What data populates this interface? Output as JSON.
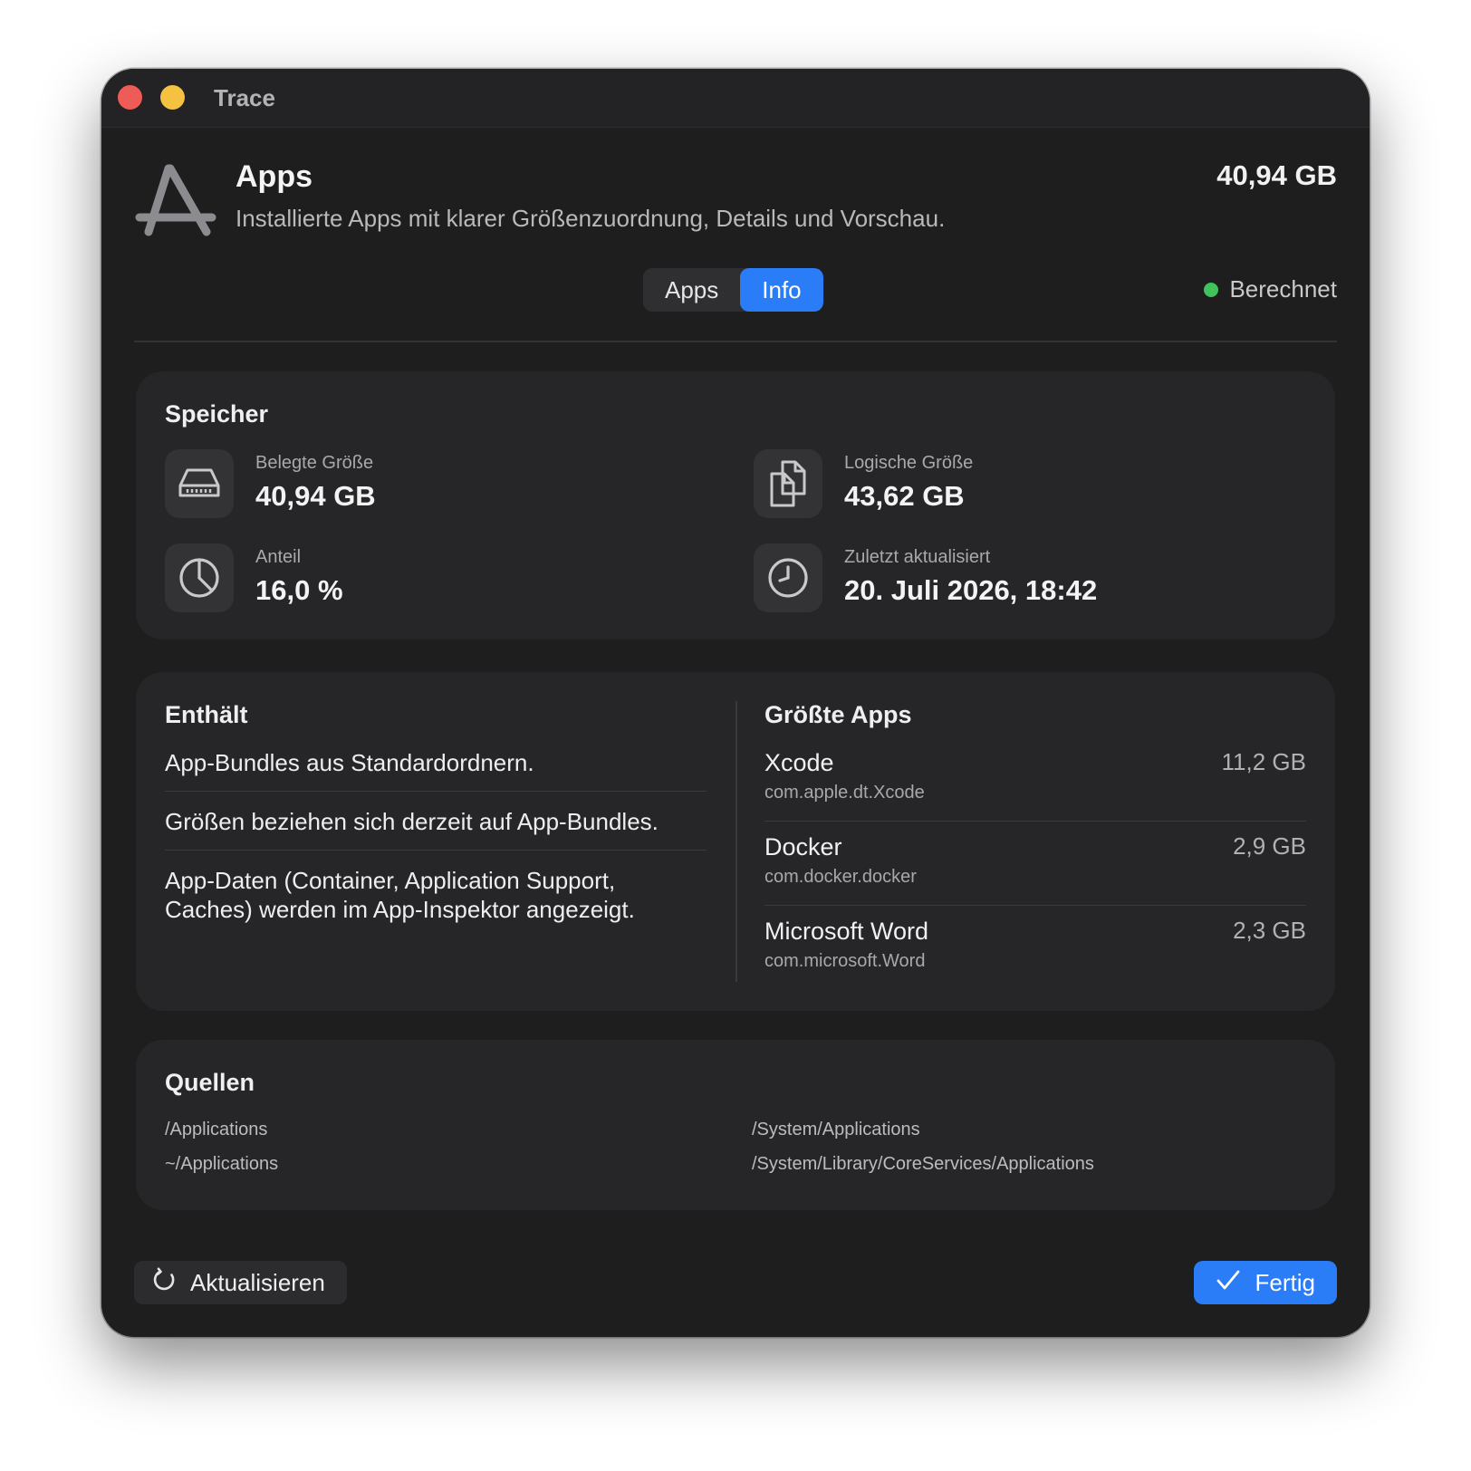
{
  "window": {
    "title": "Trace"
  },
  "header": {
    "icon": "app-store-icon",
    "title": "Apps",
    "subtitle": "Installierte Apps mit klarer Größenzuordnung, Details und Vorschau.",
    "total_size": "40,94 GB"
  },
  "tabs": [
    {
      "label": "Apps",
      "active": false
    },
    {
      "label": "Info",
      "active": true
    }
  ],
  "status": {
    "label": "Berechnet",
    "color": "#3fc35a"
  },
  "speicher": {
    "title": "Speicher",
    "stats": [
      {
        "icon": "drive-icon",
        "label": "Belegte Größe",
        "value": "40,94 GB"
      },
      {
        "icon": "documents-icon",
        "label": "Logische Größe",
        "value": "43,62 GB"
      },
      {
        "icon": "pie-chart-icon",
        "label": "Anteil",
        "value": "16,0 %"
      },
      {
        "icon": "clock-icon",
        "label": "Zuletzt aktualisiert",
        "value": "20. Juli 2026, 18:42"
      }
    ]
  },
  "enthaelt": {
    "title": "Enthält",
    "items": [
      "App-Bundles aus Standardordnern.",
      "Größen beziehen sich derzeit auf App-Bundles.",
      "App-Daten (Container, Application Support, Caches) werden im App-Inspektor angezeigt."
    ]
  },
  "groesste_apps": {
    "title": "Größte Apps",
    "apps": [
      {
        "name": "Xcode",
        "bundle_id": "com.apple.dt.Xcode",
        "size": "11,2 GB"
      },
      {
        "name": "Docker",
        "bundle_id": "com.docker.docker",
        "size": "2,9 GB"
      },
      {
        "name": "Microsoft Word",
        "bundle_id": "com.microsoft.Word",
        "size": "2,3 GB"
      }
    ]
  },
  "quellen": {
    "title": "Quellen",
    "paths": [
      "/Applications",
      "/System/Applications",
      "~/Applications",
      "/System/Library/CoreServices/Applications"
    ]
  },
  "footer": {
    "refresh_label": "Aktualisieren",
    "refresh_icon": "refresh-icon",
    "done_label": "Fertig",
    "done_icon": "checkmark-icon",
    "accent_color": "#2a7df6"
  },
  "colors": {
    "close": "#ee5c58",
    "minimize": "#f5c141",
    "background": "#1e1e1f",
    "card": "#262628"
  }
}
